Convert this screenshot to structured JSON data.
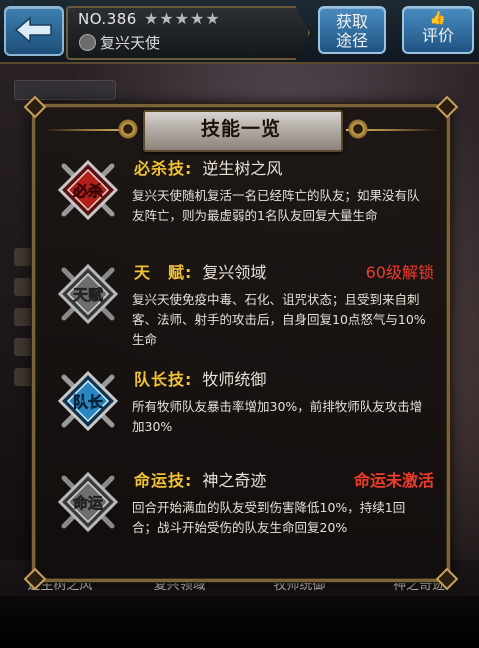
{
  "header": {
    "hero_number": "NO.386",
    "stars": "★★★★★",
    "hero_name": "复兴天使",
    "obtain_label_1": "获取",
    "obtain_label_2": "途径",
    "rate_label": "评价",
    "rate_icon": "thumbs-up-icon"
  },
  "panel": {
    "title": "技能一览",
    "skills": [
      {
        "icon": "必杀",
        "type": "必杀技:",
        "name": "逆生树之风",
        "status": "",
        "description": "复兴天使随机复活一名已经阵亡的队友；如果没有队友阵亡，则为最虚弱的1名队友回复大量生命"
      },
      {
        "icon": "天赋",
        "type": "天　赋:",
        "name": "复兴领域",
        "status": "60级解锁",
        "description": "复兴天使免疫中毒、石化、诅咒状态；且受到来自刺客、法师、射手的攻击后，自身回复10点怒气与10%生命"
      },
      {
        "icon": "队长",
        "type": "队长技:",
        "name": "牧师统御",
        "status": "",
        "description": "所有牧师队友暴击率增加30%，前排牧师队友攻击增加30%"
      },
      {
        "icon": "命运",
        "type": "命运技:",
        "name": "神之奇迹",
        "status": "命运未激活",
        "description": "回合开始满血的队友受到伤害降低10%，持续1回合；战斗开始受伤的队友生命回复20%"
      }
    ]
  },
  "bottom_bar": {
    "skill_names": [
      "逆生树之风",
      "复兴领域",
      "牧师统御",
      "神之奇迹"
    ]
  },
  "colors": {
    "skill_type": "#f1c233",
    "status_locked": "#ef3b2c",
    "panel_border": "#7a6338",
    "button_blue": "#2f6fa4"
  }
}
